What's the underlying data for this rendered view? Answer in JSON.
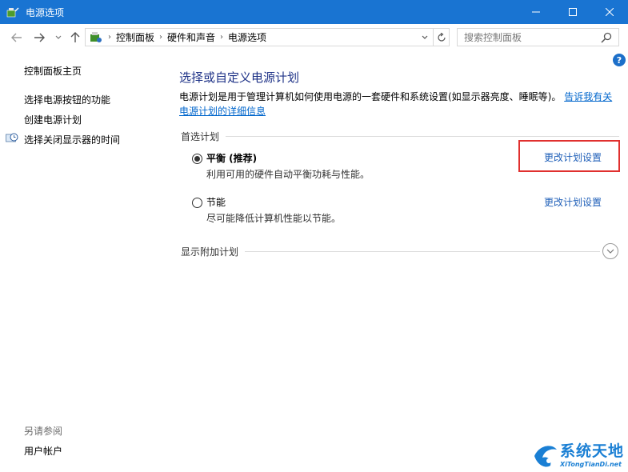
{
  "window": {
    "title": "电源选项",
    "controls": {
      "minimize": "—",
      "maximize": "☐",
      "close": "✕"
    }
  },
  "nav": {
    "back_icon": "arrow-left-icon",
    "forward_icon": "arrow-right-icon",
    "recent_icon": "chevron-down-icon",
    "up_icon": "arrow-up-icon"
  },
  "address": {
    "breadcrumbs": [
      "控制面板",
      "硬件和声音",
      "电源选项"
    ]
  },
  "search": {
    "placeholder": "搜索控制面板"
  },
  "sidebar": {
    "items": [
      {
        "label": "控制面板主页"
      },
      {
        "label": "选择电源按钮的功能"
      },
      {
        "label": "创建电源计划"
      },
      {
        "label": "选择关闭显示器的时间",
        "icon": "clock-display-icon"
      }
    ],
    "see_also": {
      "title": "另请参阅",
      "items": [
        {
          "label": "用户帐户"
        }
      ]
    }
  },
  "help": {
    "label": "?"
  },
  "main": {
    "title": "选择或自定义电源计划",
    "description": "电源计划是用于管理计算机如何使用电源的一套硬件和系统设置(如显示器亮度、睡眠等)。",
    "description_link": "告诉我有关电源计划的详细信息",
    "preferred_section": "首选计划",
    "plans": [
      {
        "name": "平衡 (推荐)",
        "desc": "利用可用的硬件自动平衡功耗与性能。",
        "link": "更改计划设置",
        "selected": true
      },
      {
        "name": "节能",
        "desc": "尽可能降低计算机性能以节能。",
        "link": "更改计划设置",
        "selected": false
      }
    ],
    "additional_section": "显示附加计划"
  },
  "watermark": {
    "text": "系统天地",
    "sub": "XiTongTianDi.net"
  },
  "colors": {
    "titlebar": "#1974d2",
    "link": "#1f5fb8",
    "heading": "#1e3287",
    "highlight": "#e0302f"
  }
}
